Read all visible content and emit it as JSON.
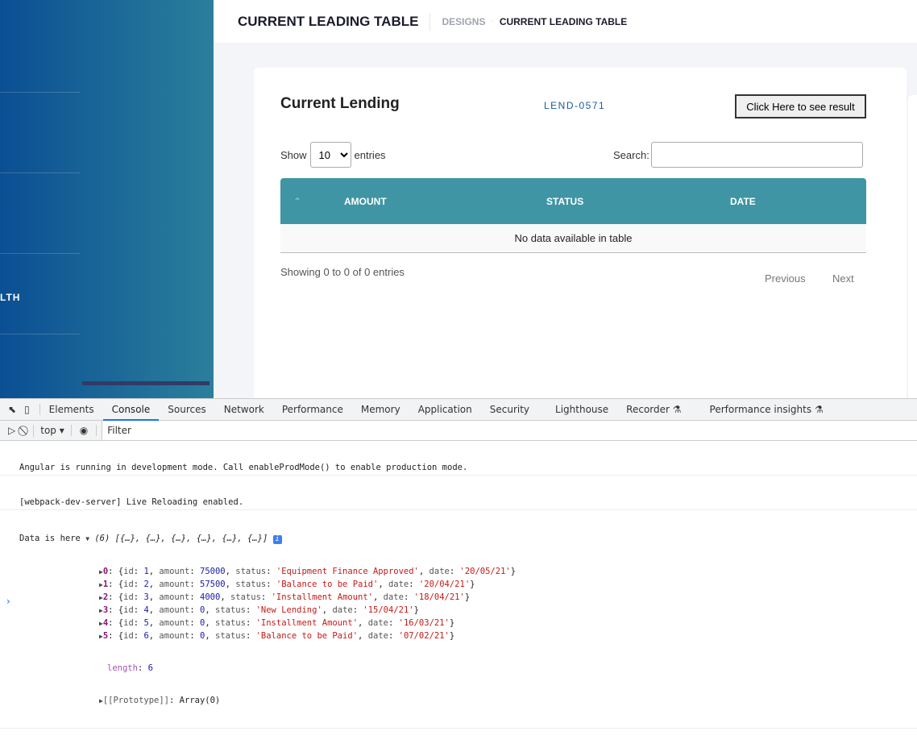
{
  "sidebar": {
    "visible_item": "LTH"
  },
  "header": {
    "title": "CURRENT LEADING TABLE",
    "breadcrumb": [
      "DESIGNS",
      "CURRENT LEADING TABLE"
    ]
  },
  "card": {
    "title": "Current Lending",
    "lend_id": "LEND-0571",
    "result_button": "Click Here to see result",
    "show_label": "Show",
    "entries_value": "10",
    "entries_label": "entries",
    "search_label": "Search:",
    "search_value": "",
    "columns": [
      "AMOUNT",
      "STATUS",
      "DATE"
    ],
    "empty_text": "No data available in table",
    "info": "Showing 0 to 0 of 0 entries",
    "prev": "Previous",
    "next": "Next"
  },
  "devtools": {
    "tabs": [
      "Elements",
      "Console",
      "Sources",
      "Network",
      "Performance",
      "Memory",
      "Application",
      "Security",
      "Lighthouse",
      "Recorder",
      "Performance insights"
    ],
    "active_tab": "Console",
    "context": "top",
    "filter_placeholder": "Filter",
    "messages": [
      "Angular is running in development mode. Call enableProdMode() to enable production mode.",
      "[webpack-dev-server] Live Reloading enabled."
    ],
    "data_log": {
      "label": "Data is here",
      "summary": "(6) [{…}, {…}, {…}, {…}, {…}, {…}]",
      "items": [
        {
          "index": "0",
          "id": "1",
          "amount": "75000",
          "status": "'Equipment Finance Approved'",
          "date": "'20/05/21'"
        },
        {
          "index": "1",
          "id": "2",
          "amount": "57500",
          "status": "'Balance to be Paid'",
          "date": "'20/04/21'"
        },
        {
          "index": "2",
          "id": "3",
          "amount": "4000",
          "status": "'Installment Amount'",
          "date": "'18/04/21'"
        },
        {
          "index": "3",
          "id": "4",
          "amount": "0",
          "status": "'New Lending'",
          "date": "'15/04/21'"
        },
        {
          "index": "4",
          "id": "5",
          "amount": "0",
          "status": "'Installment Amount'",
          "date": "'16/03/21'"
        },
        {
          "index": "5",
          "id": "6",
          "amount": "0",
          "status": "'Balance to be Paid'",
          "date": "'07/02/21'"
        }
      ],
      "length": "6",
      "prototype": "Array(0)"
    }
  }
}
